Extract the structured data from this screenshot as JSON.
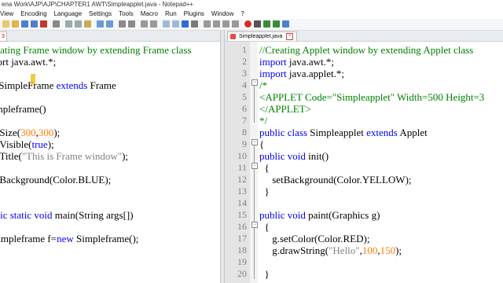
{
  "window": {
    "title": "ena Work\\AJP\\AJP\\CHAPTER1 AWT\\Simpleapplet.java - Notepad++"
  },
  "menu": [
    "View",
    "Encoding",
    "Language",
    "Settings",
    "Tools",
    "Macro",
    "Run",
    "Plugins",
    "Window",
    "?"
  ],
  "left_tab": {
    "label": "3"
  },
  "right_tab": {
    "label": "Simpleapplet.java"
  },
  "left_code": [
    [
      {
        "t": "reating Frame window by extending Frame class",
        "c": "cm"
      }
    ],
    [
      {
        "t": "port java.awt.*;",
        "c": ""
      }
    ],
    [
      {
        "t": "",
        "c": ""
      }
    ],
    [
      {
        "t": "s Simple",
        "c": ""
      },
      {
        "t": "Frame",
        "c": ""
      },
      {
        "t": " extends ",
        "c": "kw"
      },
      {
        "t": "Frame",
        "c": ""
      }
    ],
    [
      {
        "t": "",
        "c": ""
      }
    ],
    [
      {
        "t": "impleframe()",
        "c": ""
      }
    ],
    [
      {
        "t": "",
        "c": ""
      }
    ],
    [
      {
        "t": "etSize(",
        "c": ""
      },
      {
        "t": "300",
        "c": "num-lit"
      },
      {
        "t": ",",
        "c": ""
      },
      {
        "t": "300",
        "c": "num-lit"
      },
      {
        "t": ");",
        "c": ""
      }
    ],
    [
      {
        "t": "etVisible(",
        "c": ""
      },
      {
        "t": "true",
        "c": "kw"
      },
      {
        "t": ");",
        "c": ""
      }
    ],
    [
      {
        "t": "etTitle(",
        "c": ""
      },
      {
        "t": "\"This is Frame window\"",
        "c": "str"
      },
      {
        "t": ");",
        "c": ""
      }
    ],
    [
      {
        "t": "",
        "c": ""
      }
    ],
    [
      {
        "t": "etBackground(Color.BLUE);",
        "c": ""
      }
    ],
    [
      {
        "t": "",
        "c": ""
      }
    ],
    [
      {
        "t": "",
        "c": ""
      }
    ],
    [
      {
        "t": "blic static void ",
        "c": "kw"
      },
      {
        "t": "main(String args[])",
        "c": ""
      }
    ],
    [
      {
        "t": "",
        "c": ""
      }
    ],
    [
      {
        "t": "Simpleframe f=",
        "c": ""
      },
      {
        "t": "new ",
        "c": "kw"
      },
      {
        "t": "Simpleframe();",
        "c": ""
      }
    ]
  ],
  "right_code": [
    {
      "n": "1",
      "tokens": [
        {
          "t": "//Creating Applet window by extending Applet class",
          "c": "cm"
        }
      ]
    },
    {
      "n": "2",
      "tokens": [
        {
          "t": "import ",
          "c": "kw"
        },
        {
          "t": "java.awt.*;",
          "c": ""
        }
      ]
    },
    {
      "n": "3",
      "tokens": [
        {
          "t": "import ",
          "c": "kw"
        },
        {
          "t": "java.applet.*;",
          "c": ""
        }
      ]
    },
    {
      "n": "4",
      "tokens": [
        {
          "t": "/*",
          "c": "cm"
        }
      ]
    },
    {
      "n": "5",
      "tokens": [
        {
          "t": "<APPLET Code=\"Simpleapplet\" Width=500 Height=3",
          "c": "cm"
        }
      ]
    },
    {
      "n": "6",
      "tokens": [
        {
          "t": "</APPLET>",
          "c": "cm"
        }
      ]
    },
    {
      "n": "7",
      "tokens": [
        {
          "t": "*/",
          "c": "cm"
        }
      ]
    },
    {
      "n": "8",
      "tokens": [
        {
          "t": "public class ",
          "c": "kw"
        },
        {
          "t": "Simpleapplet ",
          "c": ""
        },
        {
          "t": "extends ",
          "c": "kw"
        },
        {
          "t": "Applet",
          "c": ""
        }
      ]
    },
    {
      "n": "9",
      "tokens": [
        {
          "t": "{",
          "c": ""
        }
      ]
    },
    {
      "n": "10",
      "tokens": [
        {
          "t": "public void ",
          "c": "kw"
        },
        {
          "t": "init()",
          "c": ""
        }
      ]
    },
    {
      "n": "11",
      "tokens": [
        {
          "t": "  {",
          "c": ""
        }
      ]
    },
    {
      "n": "12",
      "tokens": [
        {
          "t": "     setBackground(Color.YELLOW);",
          "c": ""
        }
      ]
    },
    {
      "n": "13",
      "tokens": [
        {
          "t": "  }",
          "c": ""
        }
      ]
    },
    {
      "n": "14",
      "tokens": [
        {
          "t": "",
          "c": ""
        }
      ]
    },
    {
      "n": "15",
      "tokens": [
        {
          "t": "public void ",
          "c": "kw"
        },
        {
          "t": "paint(Graphics g)",
          "c": ""
        }
      ]
    },
    {
      "n": "16",
      "tokens": [
        {
          "t": "  {",
          "c": ""
        }
      ]
    },
    {
      "n": "17",
      "tokens": [
        {
          "t": "     g.setColor(Color.RED);",
          "c": ""
        }
      ]
    },
    {
      "n": "18",
      "tokens": [
        {
          "t": "     g.drawString(",
          "c": ""
        },
        {
          "t": "\"Hello\"",
          "c": "str"
        },
        {
          "t": ",",
          "c": ""
        },
        {
          "t": "100",
          "c": "num-lit"
        },
        {
          "t": ",",
          "c": ""
        },
        {
          "t": "150",
          "c": "num-lit"
        },
        {
          "t": ");",
          "c": ""
        }
      ]
    },
    {
      "n": "19",
      "tokens": [
        {
          "t": "",
          "c": ""
        }
      ]
    },
    {
      "n": "20",
      "tokens": [
        {
          "t": "  }",
          "c": ""
        }
      ]
    }
  ],
  "colors": {
    "keyword": "#0000ff",
    "comment": "#008000",
    "number": "#ff8000",
    "string": "#808080"
  }
}
